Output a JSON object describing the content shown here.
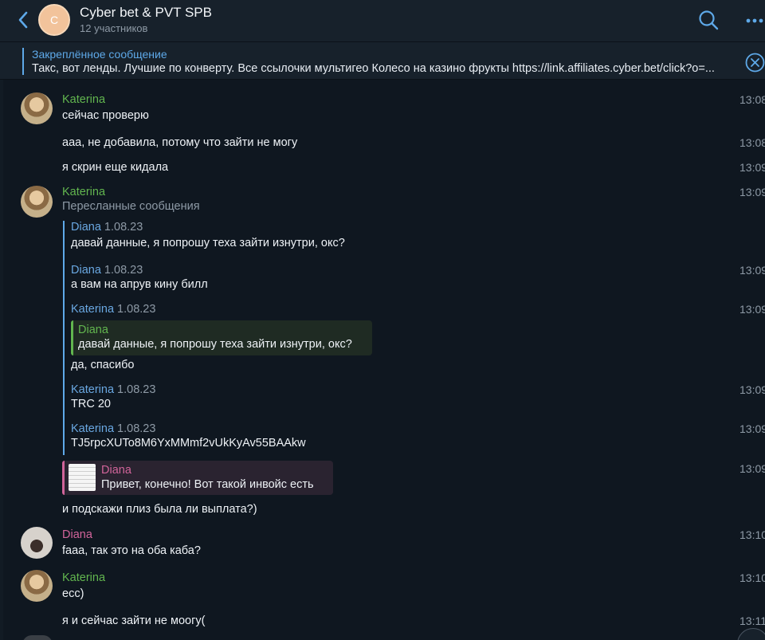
{
  "header": {
    "avatar_letter": "C",
    "title": "Cyber bet & PVT SPB",
    "subtitle": "12 участников"
  },
  "pinned": {
    "title": "Закреплённое сообщение",
    "text": "Такс, вот ленды. Лучшие по конверту. Все ссылочки мультигео  Колесо на казино фрукты https://link.affiliates.cyber.bet/click?o=..."
  },
  "messages": {
    "m1": {
      "name": "Katerina",
      "text": "сейчас проверю",
      "time": "13:08"
    },
    "m2": {
      "text": "ааа, не добавила, потому что зайти не могу",
      "time": "13:08"
    },
    "m3": {
      "text": "я скрин еще кидала",
      "time": "13:09"
    },
    "m4": {
      "name": "Katerina",
      "time": "13:09",
      "forwarded_label": "Пересланные сообщения",
      "items": [
        {
          "name": "Diana",
          "date": "1.08.23",
          "text": "давай данные, я попрошу теха зайти изнутри, окс?"
        },
        {
          "name": "Diana",
          "date": "1.08.23",
          "text": "а вам на апрув кину билл",
          "time": "13:09"
        },
        {
          "name": "Katerina",
          "date": "1.08.23",
          "time": "13:09",
          "reply_name": "Diana",
          "reply_text": "давай данные, я попрошу теха зайти изнутри, окс?",
          "text": "да, спасибо"
        },
        {
          "name": "Katerina",
          "date": "1.08.23",
          "text": "TRC 20",
          "time": "13:09"
        },
        {
          "name": "Katerina",
          "date": "1.08.23",
          "text": "TJ5rpcXUTo8M6YxMMmf2vUkKyAv55BAAkw",
          "time": "13:09"
        }
      ]
    },
    "m5": {
      "reply_name": "Diana",
      "reply_text": "Привет, конечно! Вот такой инвойс есть",
      "text": "и подскажи плиз была ли выплата?)",
      "time": "13:09"
    },
    "m6": {
      "name": "Diana",
      "text": "faaa, так это на оба каба?",
      "time": "13:10"
    },
    "m7": {
      "name": "Katerina",
      "text": "есс)",
      "time": "13:10"
    },
    "m8": {
      "text": "я и сейчас зайти не моогу(",
      "time": "13:11"
    }
  },
  "colors": {
    "background": "#0f1720",
    "header": "#17212b",
    "accent": "#5ea9e9",
    "katerina": "#62b64f",
    "diana": "#d1649a"
  }
}
